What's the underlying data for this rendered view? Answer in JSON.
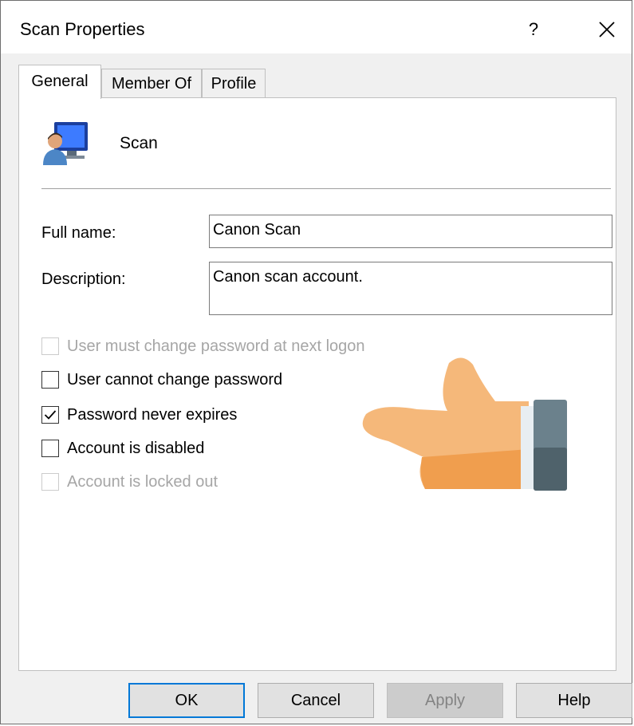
{
  "window": {
    "title": "Scan Properties",
    "help_label": "?",
    "close_icon": "close-icon"
  },
  "tabs": [
    {
      "label": "General",
      "active": true
    },
    {
      "label": "Member Of",
      "active": false
    },
    {
      "label": "Profile",
      "active": false
    }
  ],
  "general": {
    "user_icon": "user-computer-icon",
    "user_name": "Scan",
    "full_name_label": "Full name:",
    "full_name_value": "Canon Scan",
    "description_label": "Description:",
    "description_value": "Canon scan account."
  },
  "options": [
    {
      "label": "User must change password at next logon",
      "checked": false,
      "enabled": false
    },
    {
      "label": "User cannot change password",
      "checked": false,
      "enabled": true
    },
    {
      "label": "Password never expires",
      "checked": true,
      "enabled": true
    },
    {
      "label": "Account is disabled",
      "checked": false,
      "enabled": true
    },
    {
      "label": "Account is locked out",
      "checked": false,
      "enabled": false
    }
  ],
  "overlay": {
    "pointer_icon": "pointing-hand-icon"
  },
  "buttons": {
    "ok": "OK",
    "cancel": "Cancel",
    "apply": "Apply",
    "help": "Help"
  },
  "colors": {
    "dialog_bg": "#f0f0f0",
    "panel_bg": "#ffffff",
    "default_button_border": "#0078d7",
    "disabled_text": "#a6a6a6",
    "hand_skin": "#f5b87a",
    "sleeve": "#4f626b"
  }
}
